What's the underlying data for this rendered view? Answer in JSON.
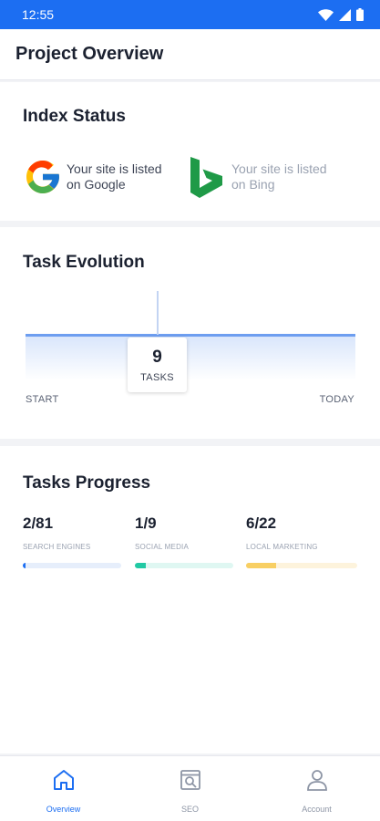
{
  "status_bar": {
    "time": "12:55"
  },
  "header": {
    "title": "Project Overview"
  },
  "index_status": {
    "title": "Index Status",
    "google": {
      "text": "Your site is listed on Google"
    },
    "bing": {
      "text": "Your site is listed on Bing"
    }
  },
  "task_evolution": {
    "title": "Task Evolution",
    "tooltip_value": "9",
    "tooltip_label": "TASKS",
    "start_label": "START",
    "end_label": "TODAY"
  },
  "tasks_progress": {
    "title": "Tasks Progress",
    "items": [
      {
        "value": "2/81",
        "label": "SEARCH ENGINES",
        "done": 2,
        "total": 81,
        "color": "#1c6ef2",
        "track": "#e6eefb"
      },
      {
        "value": "1/9",
        "label": "SOCIAL MEDIA",
        "done": 1,
        "total": 9,
        "color": "#22c9a4",
        "track": "#dff7f2"
      },
      {
        "value": "6/22",
        "label": "LOCAL MARKETING",
        "done": 6,
        "total": 22,
        "color": "#f8cf63",
        "track": "#fdf3dc"
      }
    ]
  },
  "bottom_nav": {
    "items": [
      {
        "label": "Overview",
        "icon": "home-icon",
        "active": true
      },
      {
        "label": "SEO",
        "icon": "seo-search-icon",
        "active": false
      },
      {
        "label": "Account",
        "icon": "user-icon",
        "active": false
      }
    ]
  },
  "colors": {
    "accent": "#1c6ef2"
  }
}
